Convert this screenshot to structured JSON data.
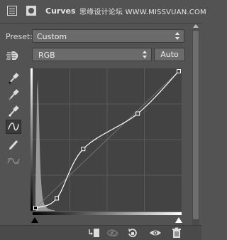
{
  "header": {
    "title": "Curves",
    "watermark": "思缘设计论坛 WWW.MISSVUAN.COM",
    "icons": [
      "adjustment-layer-icon",
      "mask-icon"
    ]
  },
  "preset": {
    "label": "Preset:",
    "value": "Custom"
  },
  "channel": {
    "value": "RGB",
    "auto_label": "Auto"
  },
  "tools": [
    "targeted-adjustment-hand-icon",
    "black-point-eyedropper-icon",
    "gray-point-eyedropper-icon",
    "white-point-eyedropper-icon",
    "curve-points-icon",
    "pencil-icon",
    "smooth-curve-icon"
  ],
  "curve": {
    "input_range": [
      0,
      255
    ],
    "output_range": [
      0,
      255
    ],
    "points": [
      [
        0,
        0
      ],
      [
        38,
        18
      ],
      [
        85,
        110
      ],
      [
        182,
        176
      ],
      [
        255,
        255
      ]
    ],
    "grid": "4x4",
    "colors": {
      "background": "#434343",
      "grid": "#5a5a5a",
      "curve": "#ffffff",
      "histogram": "#a8a8a8"
    }
  },
  "bottom_bar": {
    "icons": [
      "clip-to-layer-icon",
      "view-previous-state-icon",
      "reset-icon",
      "visibility-eye-icon",
      "trash-icon"
    ]
  }
}
